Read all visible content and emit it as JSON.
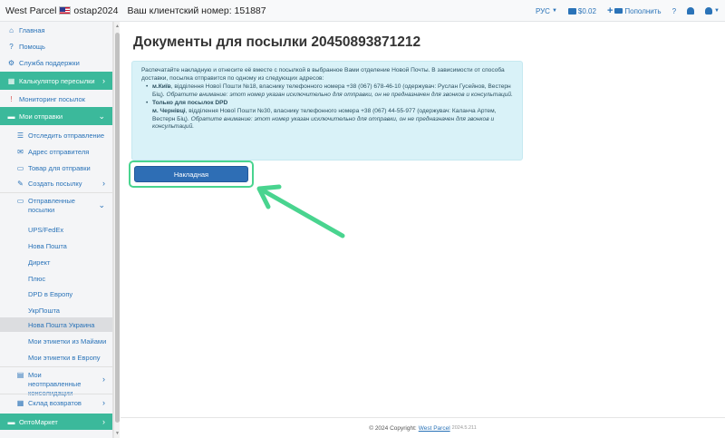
{
  "header": {
    "brand": "West Parcel",
    "username": "ostap2024",
    "client_label": "Ваш клиентский номер: 151887",
    "language": "РУС",
    "balance": "$0.02",
    "topup_label": "Пополнить",
    "help_label": "?"
  },
  "sidebar": {
    "home": "Главная",
    "help": "Помощь",
    "support": "Служба поддержки",
    "calculator": "Калькулятор пересылки",
    "monitoring": "Мониторинг посылок",
    "my_shipments": "Мои отправки",
    "track": "Отследить отправление",
    "sender_address": "Адрес отправителя",
    "goods": "Товар для отправки",
    "create_parcel": "Создать посылку",
    "sent_parcels": "Отправленные посылки",
    "carriers": [
      "UPS/FedEx",
      "Нова Пошта",
      "Директ",
      "Плюс",
      "DPD в Европу",
      "УкрПошта",
      "Нова Пошта Украина",
      "Мои этикетки из Майами",
      "Мои этикетки в Европу"
    ],
    "unsent_consolidations": "Мои неотправленные консолидации",
    "returns_warehouse": "Склад возвратов",
    "optmarket": "ОптоМаркет"
  },
  "main": {
    "title": "Документы для посылки 20450893871212",
    "info_intro": "Распечатайте накладную и отнесите её вместе с посылкой в выбранное Вами отделение Новой Почты. В зависимости от способа доставки, посылка отправится по одному из следующих адресов:",
    "addr1_city": "м.Київ",
    "addr1_text": ", відділення Нової Пошти №18, власнику телефонного номера +38 (067) 678-46-10 (одержувач: Руслан Гусейнов, Вестерн Біц).",
    "addr1_note": "Обратите внимание: этот номер указан исключительно для отправки, он не предназначен для звонков и консультаций.",
    "addr2_heading": "Только для посылок DPD",
    "addr2_city": "м. Чернівці",
    "addr2_text": ", відділення Нової Пошти №30, власнику телефонного номера +38 (067) 44-55-977 (одержувач: Каланча Артем, Вестерн Біц).",
    "addr2_note": "Обратите внимание: этот номер указан исключительно для отправки, он не предназначен для звонков и консультаций.",
    "waybill_button": "Накладная"
  },
  "footer": {
    "copyright": "© 2024 Copyright:",
    "link": "West Parcel",
    "version": "2024.5.211"
  },
  "colors": {
    "accent_green": "#3bb99b",
    "button_blue": "#2e6eb5",
    "info_bg": "#d9f2f8",
    "highlight_green": "#49d48f"
  }
}
